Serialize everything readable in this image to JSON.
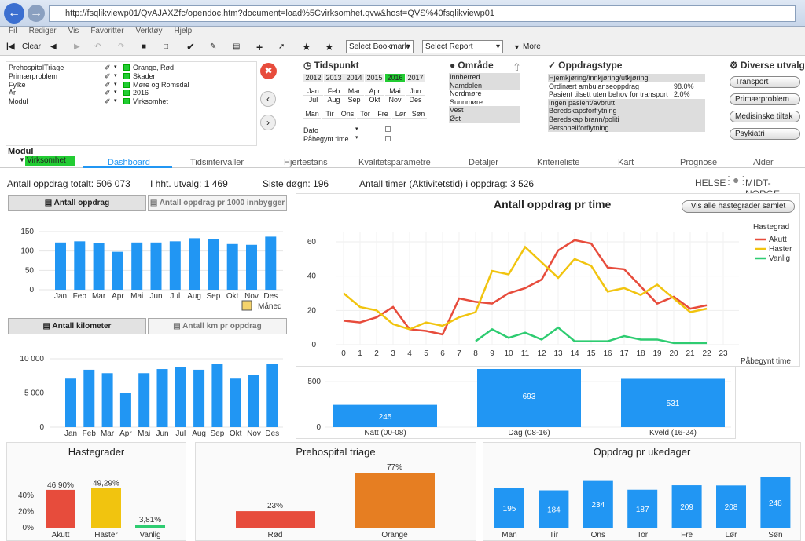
{
  "browser": {
    "url": "http://fsqlikviewp01/QvAJAXZfc/opendoc.htm?document=load%5Cvirksomhet.qvw&host=QVS%40fsqlikviewp01"
  },
  "menu": [
    "Fil",
    "Rediger",
    "Vis",
    "Favoritter",
    "Verktøy",
    "Hjelp"
  ],
  "toolbar": {
    "clear": "Clear",
    "bookmark": "Select Bookmark",
    "report": "Select Report",
    "more": "More"
  },
  "selections": [
    {
      "field": "PrehospitalTriage",
      "value": "Orange, Rød"
    },
    {
      "field": "Primærproblem",
      "value": "Skader"
    },
    {
      "field": "Fylke",
      "value": "Møre og Romsdal"
    },
    {
      "field": "År",
      "value": "2016"
    },
    {
      "field": "Modul",
      "value": "Virksomhet"
    }
  ],
  "tidspunkt": {
    "title": "Tidspunkt",
    "years": [
      "2012",
      "2013",
      "2014",
      "2015",
      "2016",
      "2017"
    ],
    "selected_year": "2016",
    "months_row1": [
      "Jan",
      "Feb",
      "Mar",
      "Apr",
      "Mai",
      "Jun"
    ],
    "months_row2": [
      "Jul",
      "Aug",
      "Sep",
      "Okt",
      "Nov",
      "Des"
    ],
    "days": [
      "Man",
      "Tir",
      "Ons",
      "Tor",
      "Fre",
      "Lør",
      "Søn"
    ],
    "dato": "Dato",
    "paabegynt": "Påbegynt time"
  },
  "omraade": {
    "title": "Område",
    "items": [
      "Innherred",
      "Namdalen",
      "Nordmøre",
      "Sunnmøre",
      "Vest",
      "Øst"
    ]
  },
  "oppdragstype": {
    "title": "Oppdragstype",
    "items": [
      {
        "label": "Hjemkjøring/innkjøring/utkjøring",
        "pct": ""
      },
      {
        "label": "Ordinært ambulanseoppdrag",
        "pct": "98.0%"
      },
      {
        "label": "Pasient tilsett uten behov for transport",
        "pct": "2.0%"
      },
      {
        "label": "Ingen pasient/avbrutt",
        "pct": ""
      },
      {
        "label": "Beredskapsforflytning",
        "pct": ""
      },
      {
        "label": "Beredskap brann/politi",
        "pct": ""
      },
      {
        "label": "Personellforflytning",
        "pct": ""
      }
    ]
  },
  "diverse": {
    "title": "Diverse utvalg",
    "buttons": [
      "Transport",
      "Primærproblem",
      "Medisinske tiltak",
      "Psykiatri"
    ]
  },
  "modul": {
    "label": "Modul",
    "value": "Virksomhet"
  },
  "tabs": [
    "Dashboard",
    "Tidsintervaller",
    "Hjertestans",
    "Kvalitetsparametre",
    "Detaljer",
    "Kriterieliste",
    "Kart",
    "Prognose",
    "Alder"
  ],
  "kpis": {
    "total": "Antall oppdrag totalt: 506 073",
    "utvalg": "I hht. utvalg: 1 469",
    "siste": "Siste døgn: 196",
    "timer": "Antall timer (Aktivitetstid) i oppdrag: 3 526"
  },
  "logo": {
    "left": "HELSE",
    "right": "MIDT-NORGE"
  },
  "monthly": {
    "btn1": "Antall oppdrag",
    "btn2": "Antall oppdrag pr 1000 innbygger",
    "months": [
      "Jan",
      "Feb",
      "Mar",
      "Apr",
      "Mai",
      "Jun",
      "Jul",
      "Aug",
      "Sep",
      "Okt",
      "Nov",
      "Des"
    ],
    "values": [
      122,
      125,
      120,
      98,
      122,
      122,
      125,
      133,
      130,
      118,
      116,
      137
    ],
    "yticks": [
      "150",
      "100",
      "50",
      "0"
    ],
    "xlabel": "Måned"
  },
  "km": {
    "btn1": "Antall kilometer",
    "btn2": "Antall km pr oppdrag",
    "months": [
      "Jan",
      "Feb",
      "Mar",
      "Apr",
      "Mai",
      "Jun",
      "Jul",
      "Aug",
      "Sep",
      "Okt",
      "Nov",
      "Des"
    ],
    "values": [
      7100,
      8400,
      7900,
      5000,
      7900,
      8500,
      8800,
      8400,
      9200,
      7100,
      7700,
      9300
    ],
    "yticks": [
      "10 000",
      "5 000",
      "0"
    ]
  },
  "hourly": {
    "title": "Antall oppdrag pr time",
    "btn": "Vis alle hastegrader samlet",
    "legend_title": "Hastegrad",
    "xlabel": "Påbegynt time",
    "yticks": [
      "60",
      "40",
      "20",
      "0"
    ],
    "series": [
      {
        "name": "Akutt",
        "color": "#e74c3c",
        "values": [
          14,
          13,
          16,
          22,
          9,
          8,
          6,
          27,
          25,
          24,
          30,
          33,
          38,
          55,
          61,
          59,
          45,
          44,
          34,
          24,
          28,
          21,
          23
        ]
      },
      {
        "name": "Haster",
        "color": "#f1c40f",
        "values": [
          30,
          22,
          20,
          12,
          9,
          13,
          11,
          16,
          19,
          43,
          41,
          57,
          48,
          39,
          50,
          46,
          31,
          33,
          29,
          35,
          27,
          19,
          21
        ]
      },
      {
        "name": "Vanlig",
        "color": "#2ecc71",
        "values": [
          null,
          null,
          null,
          null,
          null,
          null,
          null,
          null,
          2,
          9,
          4,
          7,
          3,
          10,
          2,
          2,
          2,
          5,
          3,
          3,
          1,
          1,
          1
        ]
      }
    ]
  },
  "shift": {
    "yticks": [
      "500",
      "0"
    ],
    "items": [
      {
        "label": "Natt (00-08)",
        "value": 245
      },
      {
        "label": "Dag (08-16)",
        "value": 693
      },
      {
        "label": "Kveld (16-24)",
        "value": 531
      }
    ]
  },
  "haste": {
    "title": "Hastegrader",
    "yticks": [
      "40%",
      "20%",
      "0%"
    ],
    "items": [
      {
        "label": "Akutt",
        "value": 46.9,
        "text": "46,90%",
        "color": "#e74c3c"
      },
      {
        "label": "Haster",
        "value": 49.29,
        "text": "49,29%",
        "color": "#f1c40f"
      },
      {
        "label": "Vanlig",
        "value": 3.81,
        "text": "3,81%",
        "color": "#2ecc71"
      }
    ]
  },
  "triage": {
    "title": "Prehospital triage",
    "items": [
      {
        "label": "Rød",
        "value": 23,
        "text": "23%",
        "color": "#e74c3c"
      },
      {
        "label": "Orange",
        "value": 77,
        "text": "77%",
        "color": "#e67e22"
      }
    ]
  },
  "ukedag": {
    "title": "Oppdrag pr ukedager",
    "items": [
      {
        "label": "Man",
        "value": 195
      },
      {
        "label": "Tir",
        "value": 184
      },
      {
        "label": "Ons",
        "value": 234
      },
      {
        "label": "Tor",
        "value": 187
      },
      {
        "label": "Fre",
        "value": 209
      },
      {
        "label": "Lør",
        "value": 208
      },
      {
        "label": "Søn",
        "value": 248
      }
    ]
  }
}
